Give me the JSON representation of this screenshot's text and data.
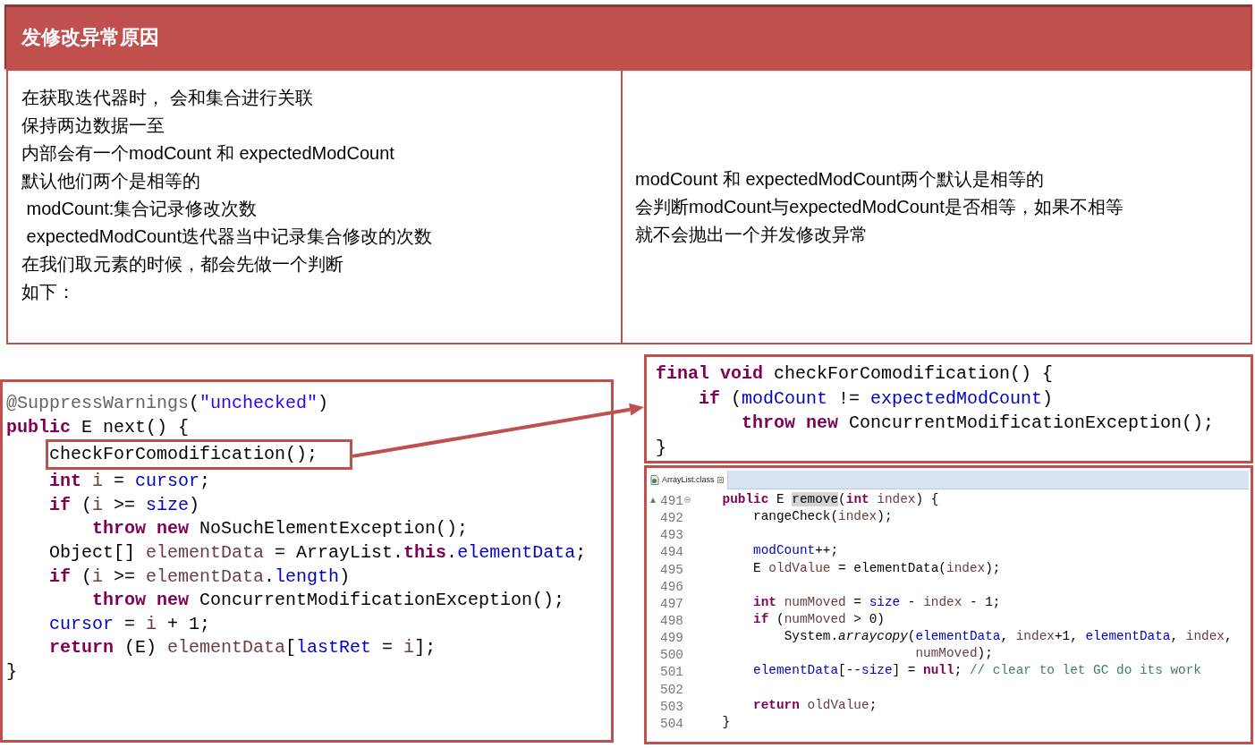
{
  "slide_title": "发修改异常原因",
  "explanation_table": {
    "left_cell": [
      "在获取迭代器时， 会和集合进行关联",
      "保持两边数据一至",
      "内部会有一个modCount 和 expectedModCount",
      "默认他们两个是相等的",
      " modCount:集合记录修改次数",
      " expectedModCount迭代器当中记录集合修改的次数",
      "在我们取元素的时候，都会先做一个判断",
      "如下："
    ],
    "right_cell": [
      "modCount 和 expectedModCount两个默认是相等的",
      "会判断modCount与expectedModCount是否相等，如果不相等",
      "就不会抛出一个并发修改异常"
    ]
  },
  "next_method_code": {
    "lines": [
      {
        "outlined": false,
        "segments": [
          {
            "text": "@SuppressWarnings",
            "kind": "annotation"
          },
          {
            "text": "(",
            "kind": "plain"
          },
          {
            "text": "\"unchecked\"",
            "kind": "string"
          },
          {
            "text": ")",
            "kind": "plain"
          }
        ]
      },
      {
        "outlined": false,
        "segments": [
          {
            "text": "public",
            "kind": "keyword"
          },
          {
            "text": " E next() {",
            "kind": "plain"
          }
        ]
      },
      {
        "outlined": true,
        "segments": [
          {
            "text": "    checkForComodification();",
            "kind": "plain"
          }
        ]
      },
      {
        "outlined": false,
        "segments": [
          {
            "text": "    int",
            "kind": "keyword"
          },
          {
            "text": " i",
            "kind": "local"
          },
          {
            "text": " = ",
            "kind": "plain"
          },
          {
            "text": "cursor",
            "kind": "field"
          },
          {
            "text": ";",
            "kind": "plain"
          }
        ]
      },
      {
        "outlined": false,
        "segments": [
          {
            "text": "    if",
            "kind": "keyword"
          },
          {
            "text": " (",
            "kind": "plain"
          },
          {
            "text": "i",
            "kind": "local"
          },
          {
            "text": " >= ",
            "kind": "plain"
          },
          {
            "text": "size",
            "kind": "field"
          },
          {
            "text": ")",
            "kind": "plain"
          }
        ]
      },
      {
        "outlined": false,
        "segments": [
          {
            "text": "        throw new",
            "kind": "keyword"
          },
          {
            "text": " NoSuchElementException();",
            "kind": "plain"
          }
        ]
      },
      {
        "outlined": false,
        "segments": [
          {
            "text": "    Object[] ",
            "kind": "plain"
          },
          {
            "text": "elementData",
            "kind": "local"
          },
          {
            "text": " = ArrayList.",
            "kind": "plain"
          },
          {
            "text": "this",
            "kind": "keyword"
          },
          {
            "text": ".",
            "kind": "plain"
          },
          {
            "text": "elementData",
            "kind": "field"
          },
          {
            "text": ";",
            "kind": "plain"
          }
        ]
      },
      {
        "outlined": false,
        "segments": [
          {
            "text": "    if",
            "kind": "keyword"
          },
          {
            "text": " (",
            "kind": "plain"
          },
          {
            "text": "i",
            "kind": "local"
          },
          {
            "text": " >= ",
            "kind": "plain"
          },
          {
            "text": "elementData",
            "kind": "local"
          },
          {
            "text": ".",
            "kind": "plain"
          },
          {
            "text": "length",
            "kind": "field"
          },
          {
            "text": ")",
            "kind": "plain"
          }
        ]
      },
      {
        "outlined": false,
        "segments": [
          {
            "text": "        throw new",
            "kind": "keyword"
          },
          {
            "text": " ConcurrentModificationException();",
            "kind": "plain"
          }
        ]
      },
      {
        "outlined": false,
        "segments": [
          {
            "text": "    cursor",
            "kind": "field"
          },
          {
            "text": " = ",
            "kind": "plain"
          },
          {
            "text": "i",
            "kind": "local"
          },
          {
            "text": " + 1;",
            "kind": "plain"
          }
        ]
      },
      {
        "outlined": false,
        "segments": [
          {
            "text": "    return",
            "kind": "keyword"
          },
          {
            "text": " (E) ",
            "kind": "plain"
          },
          {
            "text": "elementData",
            "kind": "local"
          },
          {
            "text": "[",
            "kind": "plain"
          },
          {
            "text": "lastRet",
            "kind": "field"
          },
          {
            "text": " = ",
            "kind": "plain"
          },
          {
            "text": "i",
            "kind": "local"
          },
          {
            "text": "];",
            "kind": "plain"
          }
        ]
      },
      {
        "outlined": false,
        "segments": [
          {
            "text": "}",
            "kind": "plain"
          }
        ]
      }
    ]
  },
  "check_method_code": {
    "lines": [
      {
        "segments": [
          {
            "text": "final void",
            "kind": "keyword"
          },
          {
            "text": " checkForComodification() {",
            "kind": "plain"
          }
        ]
      },
      {
        "segments": [
          {
            "text": "    if",
            "kind": "keyword"
          },
          {
            "text": " (",
            "kind": "plain"
          },
          {
            "text": "modCount",
            "kind": "field"
          },
          {
            "text": " != ",
            "kind": "plain"
          },
          {
            "text": "expectedModCount",
            "kind": "field"
          },
          {
            "text": ")",
            "kind": "plain"
          }
        ]
      },
      {
        "segments": [
          {
            "text": "        throw new",
            "kind": "keyword"
          },
          {
            "text": " ConcurrentModificationException();",
            "kind": "plain"
          }
        ]
      },
      {
        "segments": [
          {
            "text": "}",
            "kind": "plain"
          }
        ]
      }
    ]
  },
  "editor": {
    "tab": {
      "label": "ArrayList.class",
      "selected": true
    },
    "lines": [
      {
        "number": "491",
        "method_start": true,
        "segments": [
          {
            "text": "    public",
            "kind": "keyword"
          },
          {
            "text": " E ",
            "kind": "plain"
          },
          {
            "text": "remove",
            "kind": "occurrence"
          },
          {
            "text": "(",
            "kind": "plain"
          },
          {
            "text": "int",
            "kind": "keyword"
          },
          {
            "text": " index",
            "kind": "local"
          },
          {
            "text": ") {",
            "kind": "plain"
          }
        ]
      },
      {
        "number": "492",
        "method_start": false,
        "segments": [
          {
            "text": "        rangeCheck(",
            "kind": "plain"
          },
          {
            "text": "index",
            "kind": "local"
          },
          {
            "text": ");",
            "kind": "plain"
          }
        ]
      },
      {
        "number": "493",
        "method_start": false
      },
      {
        "number": "494",
        "method_start": false,
        "segments": [
          {
            "text": "        modCount",
            "kind": "field"
          },
          {
            "text": "++;",
            "kind": "plain"
          }
        ]
      },
      {
        "number": "495",
        "method_start": false,
        "segments": [
          {
            "text": "        E ",
            "kind": "plain"
          },
          {
            "text": "oldValue",
            "kind": "local"
          },
          {
            "text": " = elementData(",
            "kind": "plain"
          },
          {
            "text": "index",
            "kind": "local"
          },
          {
            "text": ");",
            "kind": "plain"
          }
        ]
      },
      {
        "number": "496",
        "method_start": false
      },
      {
        "number": "497",
        "method_start": false,
        "segments": [
          {
            "text": "        int",
            "kind": "keyword"
          },
          {
            "text": " numMoved",
            "kind": "local"
          },
          {
            "text": " = ",
            "kind": "plain"
          },
          {
            "text": "size",
            "kind": "field"
          },
          {
            "text": " - ",
            "kind": "plain"
          },
          {
            "text": "index",
            "kind": "local"
          },
          {
            "text": " - 1;",
            "kind": "plain"
          }
        ]
      },
      {
        "number": "498",
        "method_start": false,
        "segments": [
          {
            "text": "        if",
            "kind": "keyword"
          },
          {
            "text": " (",
            "kind": "plain"
          },
          {
            "text": "numMoved",
            "kind": "local"
          },
          {
            "text": " > 0)",
            "kind": "plain"
          }
        ]
      },
      {
        "number": "499",
        "method_start": false,
        "segments": [
          {
            "text": "            System.",
            "kind": "plain"
          },
          {
            "text": "arraycopy",
            "kind": "static_method"
          },
          {
            "text": "(",
            "kind": "plain"
          },
          {
            "text": "elementData",
            "kind": "field"
          },
          {
            "text": ", ",
            "kind": "plain"
          },
          {
            "text": "index",
            "kind": "local"
          },
          {
            "text": "+1, ",
            "kind": "plain"
          },
          {
            "text": "elementData",
            "kind": "field"
          },
          {
            "text": ", ",
            "kind": "plain"
          },
          {
            "text": "index",
            "kind": "local"
          },
          {
            "text": ",",
            "kind": "plain"
          }
        ]
      },
      {
        "number": "500",
        "method_start": false,
        "segments": [
          {
            "text": "                             numMoved",
            "kind": "local"
          },
          {
            "text": ");",
            "kind": "plain"
          }
        ]
      },
      {
        "number": "501",
        "method_start": false,
        "segments": [
          {
            "text": "        elementData",
            "kind": "field"
          },
          {
            "text": "[--",
            "kind": "plain"
          },
          {
            "text": "size",
            "kind": "field"
          },
          {
            "text": "] = ",
            "kind": "plain"
          },
          {
            "text": "null",
            "kind": "keyword"
          },
          {
            "text": "; ",
            "kind": "plain"
          },
          {
            "text": "// clear to let GC do its work",
            "kind": "comment"
          }
        ]
      },
      {
        "number": "502",
        "method_start": false
      },
      {
        "number": "503",
        "method_start": false,
        "segments": [
          {
            "text": "        return",
            "kind": "keyword"
          },
          {
            "text": " oldValue",
            "kind": "local"
          },
          {
            "text": ";",
            "kind": "plain"
          }
        ]
      },
      {
        "number": "504",
        "method_start": false,
        "segments": [
          {
            "text": "    }",
            "kind": "plain"
          }
        ]
      }
    ]
  }
}
